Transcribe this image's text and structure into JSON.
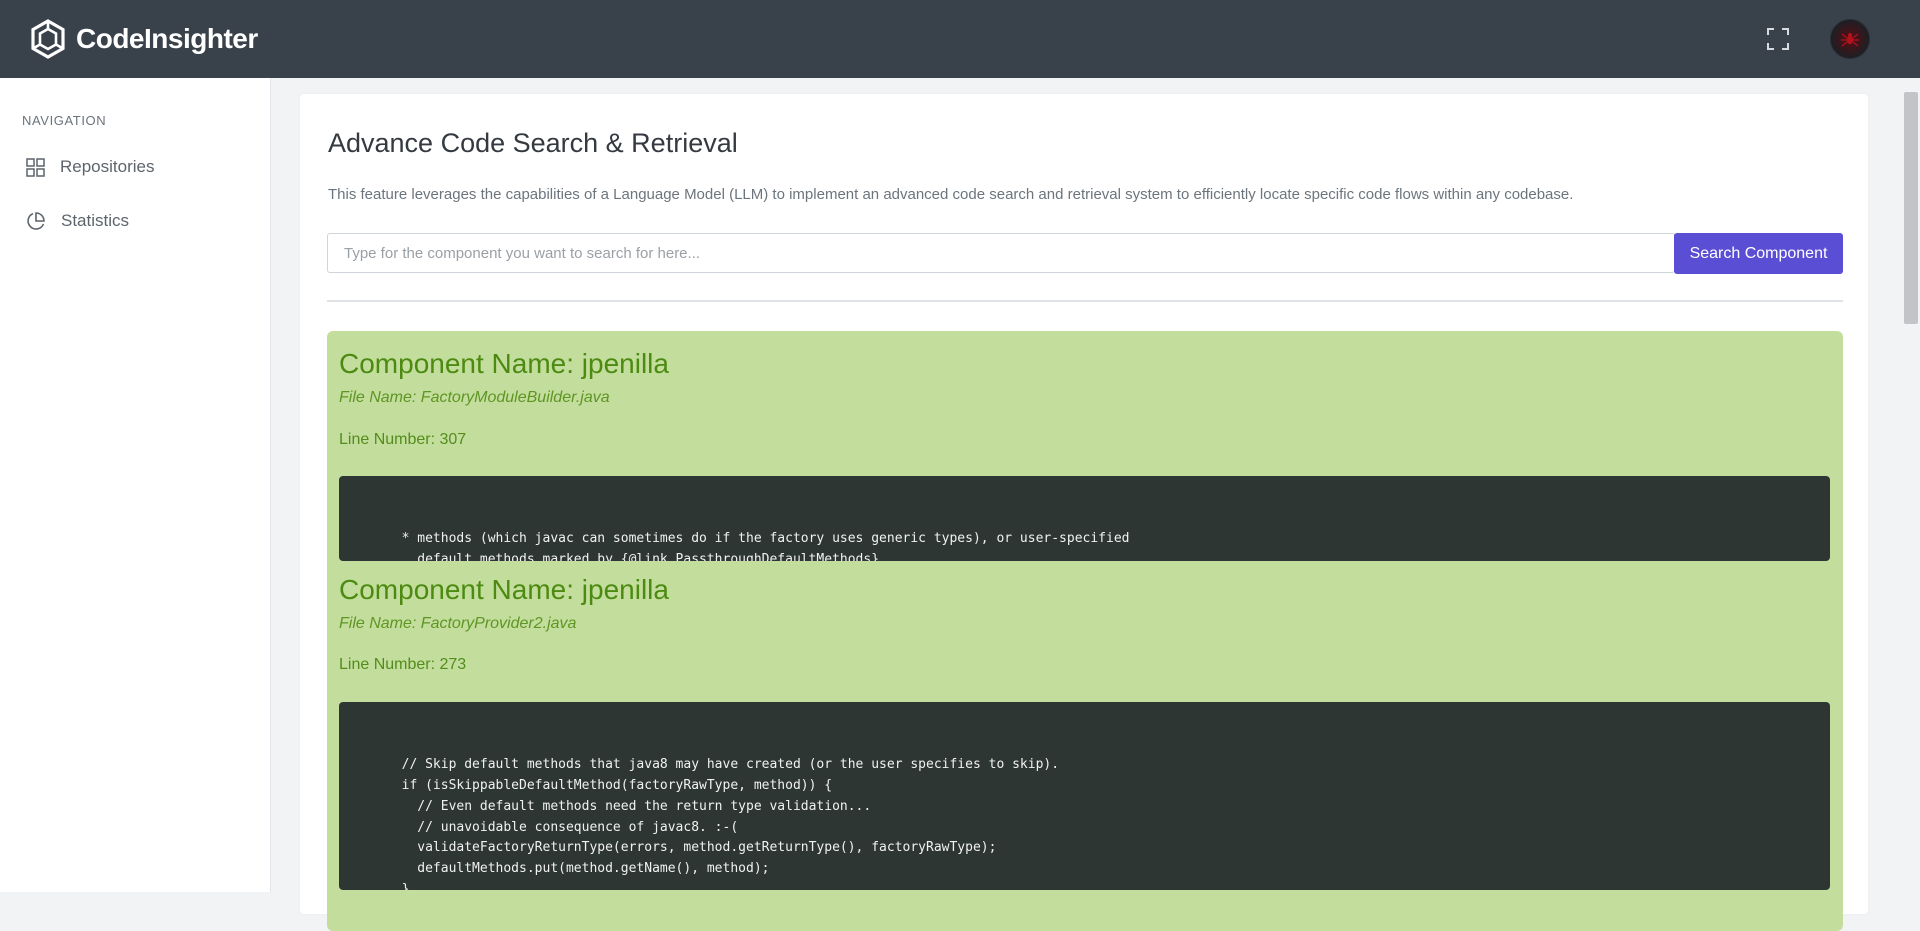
{
  "app": {
    "name": "CodeInsighter"
  },
  "header": {
    "fullscreen_icon": "fullscreen-icon",
    "avatar_icon": "user-avatar"
  },
  "sidebar": {
    "heading": "NAVIGATION",
    "items": [
      {
        "label": "Repositories",
        "icon": "grid-icon"
      },
      {
        "label": "Statistics",
        "icon": "pie-chart-icon"
      }
    ]
  },
  "main": {
    "title": "Advance Code Search & Retrieval",
    "description": "This feature leverages the capabilities of a Language Model (LLM) to implement an advanced code search and retrieval system to efficiently locate specific code flows within any codebase.",
    "search": {
      "placeholder": "Type for the component you want to search for here...",
      "value": "",
      "button_label": "Search Component"
    },
    "results": [
      {
        "component": "Component Name: jpenilla",
        "file": "File Name: FactoryModuleBuilder.java",
        "line": "Line Number: 307",
        "code": [
          "        * methods (which javac can sometimes do if the factory uses generic types), or user-specified",
          "          default methods marked by {@link PassthroughDefaultMethods}."
        ]
      },
      {
        "component": "Component Name: jpenilla",
        "file": "File Name: FactoryProvider2.java",
        "line": "Line Number: 273",
        "code": [
          "        // Skip default methods that java8 may have created (or the user specifies to skip).",
          "        if (isSkippableDefaultMethod(factoryRawType, method)) {",
          "          // Even default methods need the return type validation...",
          "          // unavoidable consequence of javac8. :-(",
          "          validateFactoryReturnType(errors, method.getReturnType(), factoryRawType);",
          "          defaultMethods.put(method.getName(), method);",
          "        }"
        ]
      }
    ]
  },
  "colors": {
    "topbar": "#39414a",
    "accent": "#5a4fd4",
    "result_bg": "#c3de9c",
    "result_title": "#4c8a12",
    "code_bg": "#2d3633"
  }
}
